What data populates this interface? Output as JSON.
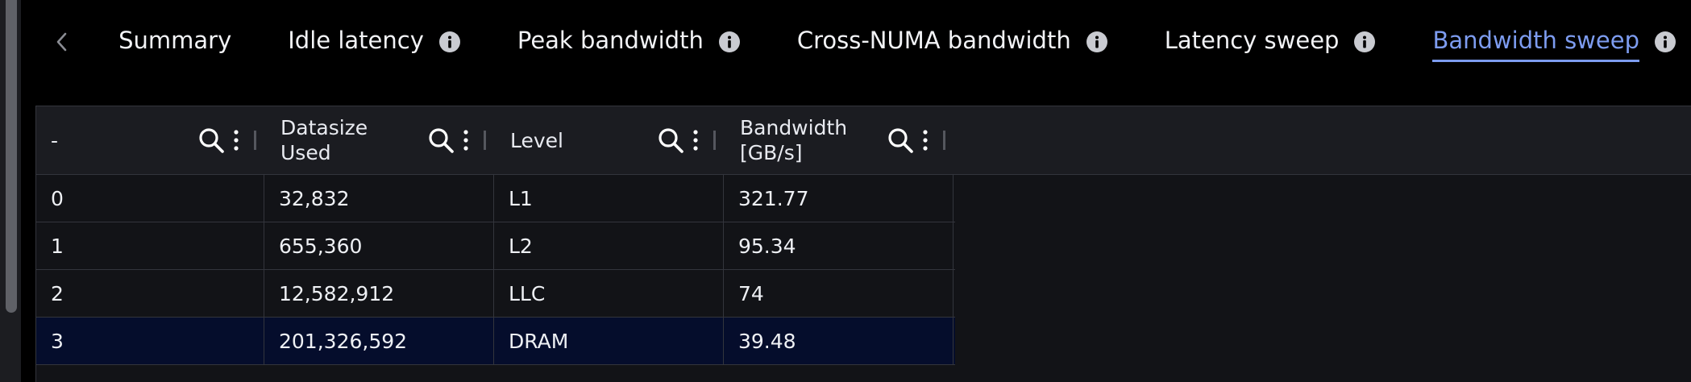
{
  "tabs": {
    "items": [
      {
        "label": "Summary",
        "active": false
      },
      {
        "label": "Idle latency",
        "active": false
      },
      {
        "label": "Peak bandwidth",
        "active": false
      },
      {
        "label": "Cross-NUMA bandwidth",
        "active": false
      },
      {
        "label": "Latency sweep",
        "active": false
      },
      {
        "label": "Bandwidth sweep",
        "active": true
      }
    ],
    "accent_color": "#7d9cf0"
  },
  "table": {
    "columns": [
      {
        "label": "-"
      },
      {
        "label": "Datasize\nUsed"
      },
      {
        "label": "Level"
      },
      {
        "label": "Bandwidth\n[GB/s]"
      }
    ],
    "rows": [
      [
        "0",
        "32,832",
        "L1",
        "321.77"
      ],
      [
        "1",
        "655,360",
        "L2",
        "95.34"
      ],
      [
        "2",
        "12,582,912",
        "LLC",
        "74"
      ],
      [
        "3",
        "201,326,592",
        "DRAM",
        "39.48"
      ]
    ],
    "selected_row": 3,
    "selected_row_color": "#050d2c"
  }
}
